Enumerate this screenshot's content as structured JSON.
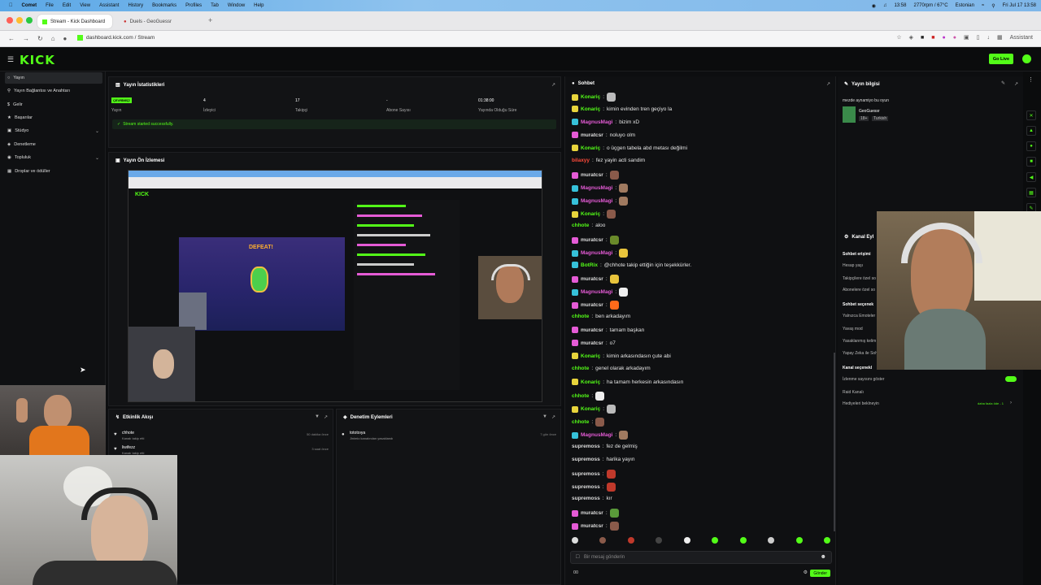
{
  "menubar": {
    "app": "Comet",
    "items": [
      "File",
      "Edit",
      "View",
      "Assistant",
      "History",
      "Bookmarks",
      "Profiles",
      "Tab",
      "Window",
      "Help"
    ],
    "time": "13:58",
    "cpu": "2770rpm / 67°C",
    "locale": "Estonian",
    "date": "Fri Jul 17  13:58"
  },
  "tabs": [
    {
      "label": "Stream - Kick Dashboard"
    },
    {
      "label": "Duels - GeoGuessr"
    }
  ],
  "urlbar": {
    "url": "dashboard.kick.com / Stream",
    "assistant": "Assistant"
  },
  "header": {
    "logo": "KICK",
    "go_live": "Go Live"
  },
  "sidebar": {
    "items": [
      {
        "label": "Yayın",
        "icon": "broadcast-icon",
        "active": true
      },
      {
        "label": "Yayın Bağlantısı ve Anahtarı",
        "icon": "key-icon"
      },
      {
        "label": "Gelir",
        "icon": "money-icon"
      },
      {
        "label": "Başarılar",
        "icon": "trophy-icon"
      },
      {
        "label": "Stüdyo",
        "icon": "studio-icon",
        "chevron": true
      },
      {
        "label": "Denetleme",
        "icon": "shield-icon"
      },
      {
        "label": "Topluluk",
        "icon": "community-icon",
        "chevron": true
      },
      {
        "label": "Droplar ve ödüller",
        "icon": "gift-icon"
      }
    ]
  },
  "stats": {
    "title": "Yayın İstatistikleri",
    "live_badge": "ÇEVRİMİÇİ",
    "items": [
      {
        "value": "",
        "label": "Yayın"
      },
      {
        "value": "4",
        "label": "İzleyici"
      },
      {
        "value": "17",
        "label": "Takipçi"
      },
      {
        "value": "-",
        "label": "Abone Sayısı"
      },
      {
        "value": "01:38:00",
        "label": "Yayında Olduğu Süre"
      }
    ],
    "notice": "Stream started successfully."
  },
  "preview": {
    "title": "Yayın Ön İzlemesi",
    "game_text": "DEFEAT!"
  },
  "activity": {
    "title": "Etkinlik Akışı",
    "items": [
      {
        "user": "chhote",
        "action": "Kanalı takip etti",
        "time": "50 dakika önce"
      },
      {
        "user": "liwifezz",
        "action": "Kanalı takip etti",
        "time": "3 saat önce"
      }
    ]
  },
  "moderation": {
    "title": "Denetim Eylemleri",
    "items": [
      {
        "user": "tototoıya",
        "action": "Jinimio kanalından yasaklandı",
        "time": "7 gün önce"
      }
    ]
  },
  "chat": {
    "title": "Sohbet",
    "input_placeholder": "Bir mesaj gönderin",
    "send_label": "Gönder",
    "count": "00",
    "messages": [
      {
        "user": "Konariç",
        "text": "",
        "color": "#53fc18",
        "badge": "#e8d43c",
        "emote": "#bbbbbb"
      },
      {
        "user": "Konariç",
        "text": "kimin evinden tren geçiyo la",
        "color": "#53fc18",
        "badge": "#e8d43c"
      },
      {
        "user": "MagnusMagi",
        "text": "bizim xD",
        "color": "#e55bd6",
        "badge": "#36c1d9"
      },
      {
        "user": "muratcsr",
        "text": "noluyo olm",
        "color": "#dddddd",
        "badge": "#e55bd6"
      },
      {
        "user": "Konariç",
        "text": "o üçgen tabela abd metası değilmi",
        "color": "#53fc18",
        "badge": "#e8d43c"
      },
      {
        "user": "bilaxyy",
        "text": "fez yayin acti sandim",
        "color": "#ff4a3a"
      },
      {
        "user": "muratcsr",
        "text": "",
        "color": "#dddddd",
        "badge": "#e55bd6",
        "emote": "#8a5a4a"
      },
      {
        "user": "MagnusMagi",
        "text": "",
        "color": "#e55bd6",
        "badge": "#36c1d9",
        "emote": "#a07a60"
      },
      {
        "user": "MagnusMagi",
        "text": "",
        "color": "#e55bd6",
        "badge": "#36c1d9",
        "emote": "#a07a60"
      },
      {
        "user": "Konariç",
        "text": "",
        "color": "#53fc18",
        "badge": "#e8d43c",
        "emote": "#8a5a4a"
      },
      {
        "user": "chhote",
        "text": "aloo",
        "color": "#53fc18"
      },
      {
        "user": "muratcsr",
        "text": "",
        "color": "#dddddd",
        "badge": "#e55bd6",
        "emote": "#6a8a2a"
      },
      {
        "user": "MagnusMagi",
        "text": "",
        "color": "#e55bd6",
        "badge": "#36c1d9",
        "emote": "#e8c43c"
      },
      {
        "user": "BotRix",
        "text": "@chhote takip ettiğin için teşekkürler.",
        "color": "#53fc18",
        "badge": "#36c1d9"
      },
      {
        "user": "muratcsr",
        "text": "",
        "color": "#dddddd",
        "badge": "#e55bd6",
        "emote": "#e8c43c"
      },
      {
        "user": "MagnusMagi",
        "text": "",
        "color": "#e55bd6",
        "badge": "#36c1d9",
        "emote": "#eeeeee"
      },
      {
        "user": "muratcsr",
        "text": "",
        "color": "#dddddd",
        "badge": "#e55bd6",
        "emote": "#ff6a1a"
      },
      {
        "user": "chhote",
        "text": "ben arkadayım",
        "color": "#53fc18"
      },
      {
        "user": "muratcsr",
        "text": "tamam başkan",
        "color": "#dddddd",
        "badge": "#e55bd6"
      },
      {
        "user": "muratcsr",
        "text": "o7",
        "color": "#dddddd",
        "badge": "#e55bd6"
      },
      {
        "user": "Konariç",
        "text": "kimin arkasındasın çute abi",
        "color": "#53fc18",
        "badge": "#e8d43c"
      },
      {
        "user": "chhote",
        "text": "genel olarak arkadayım",
        "color": "#53fc18"
      },
      {
        "user": "Konariç",
        "text": "ha tamam herkesin arkasındasın",
        "color": "#53fc18",
        "badge": "#e8d43c"
      },
      {
        "user": "chhote",
        "text": "",
        "color": "#53fc18",
        "emote": "#eeeeee"
      },
      {
        "user": "Konariç",
        "text": "",
        "color": "#53fc18",
        "badge": "#e8d43c",
        "emote": "#bbbbbb"
      },
      {
        "user": "chhote",
        "text": "",
        "color": "#53fc18",
        "emote": "#8a5a4a"
      },
      {
        "user": "MagnusMagi",
        "text": "",
        "color": "#e55bd6",
        "badge": "#36c1d9",
        "emote": "#a07a60"
      },
      {
        "user": "supremoss",
        "text": "fez de gelmiş",
        "color": "#dddddd"
      },
      {
        "user": "supremoss",
        "text": "harika yayın",
        "color": "#dddddd"
      },
      {
        "user": "supremoss",
        "text": "",
        "color": "#dddddd",
        "emote": "#c0392b"
      },
      {
        "user": "supremoss",
        "text": "",
        "color": "#dddddd",
        "emote": "#c0392b"
      },
      {
        "user": "supremoss",
        "text": "kır",
        "color": "#dddddd"
      },
      {
        "user": "muratcsr",
        "text": "",
        "color": "#dddddd",
        "badge": "#e55bd6",
        "emote": "#5a9a3a"
      },
      {
        "user": "muratcsr",
        "text": "",
        "color": "#dddddd",
        "badge": "#e55bd6",
        "emote": "#8a5a4a"
      }
    ]
  },
  "stream_info": {
    "title": "Yayın bilgisi",
    "desc": "mezde aynamiyo bu oyun",
    "category": "GeoGuessr",
    "tags": [
      "18+",
      "Turkish"
    ]
  },
  "channel_settings": {
    "title": "Kanal Eyl",
    "section1": "Sohbet erişimi",
    "s1_items": [
      "Hesap yaşı",
      "Takipçilere özel so",
      "Abonelere özel so"
    ],
    "section2": "Sohbet seçenek",
    "s2_items": [
      "Yalnızca Emoteler",
      "Yavaş mod",
      "Yasaklanmış kelim",
      "Yapay Zeka ile Soh"
    ],
    "section3": "Kanal seçenekl",
    "s3_items": [
      "İzlenme sayısını göster",
      "Raid Kanalı",
      "Hediyeleri beklneyin"
    ],
    "s3_extra": "daha fazla öde - 1"
  },
  "colors": {
    "accent": "#53fc18",
    "bg": "#0d0e10"
  }
}
